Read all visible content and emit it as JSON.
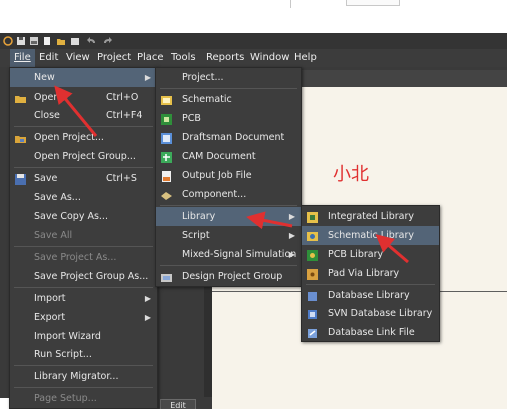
{
  "menubar": {
    "items": [
      "File",
      "Edit",
      "View",
      "Project",
      "Place",
      "Tools",
      "Reports",
      "Window",
      "Help"
    ]
  },
  "file_menu": {
    "items": [
      {
        "label": "New",
        "shortcut": "",
        "submenu": true,
        "highlighted": true,
        "disabled": false,
        "icon": ""
      },
      {
        "label": "Open...",
        "shortcut": "Ctrl+O",
        "submenu": false,
        "disabled": false,
        "icon": "folder-icon"
      },
      {
        "label": "Close",
        "shortcut": "Ctrl+F4",
        "submenu": false,
        "disabled": false,
        "icon": ""
      },
      {
        "label": "Open Project...",
        "shortcut": "",
        "submenu": false,
        "disabled": false,
        "icon": "open-project-icon"
      },
      {
        "label": "Open Project Group...",
        "shortcut": "",
        "submenu": false,
        "disabled": false,
        "icon": ""
      },
      {
        "label": "Save",
        "shortcut": "Ctrl+S",
        "submenu": false,
        "disabled": false,
        "icon": "save-icon"
      },
      {
        "label": "Save As...",
        "shortcut": "",
        "submenu": false,
        "disabled": false,
        "icon": ""
      },
      {
        "label": "Save Copy As...",
        "shortcut": "",
        "submenu": false,
        "disabled": false,
        "icon": ""
      },
      {
        "label": "Save All",
        "shortcut": "",
        "submenu": false,
        "disabled": true,
        "icon": ""
      },
      {
        "label": "Save Project As...",
        "shortcut": "",
        "submenu": false,
        "disabled": true,
        "icon": ""
      },
      {
        "label": "Save Project Group As...",
        "shortcut": "",
        "submenu": false,
        "disabled": false,
        "icon": ""
      },
      {
        "label": "Import",
        "shortcut": "",
        "submenu": true,
        "disabled": false,
        "icon": ""
      },
      {
        "label": "Export",
        "shortcut": "",
        "submenu": true,
        "disabled": false,
        "icon": ""
      },
      {
        "label": "Import Wizard",
        "shortcut": "",
        "submenu": false,
        "disabled": false,
        "icon": ""
      },
      {
        "label": "Run Script...",
        "shortcut": "",
        "submenu": false,
        "disabled": false,
        "icon": ""
      },
      {
        "label": "Library Migrator...",
        "shortcut": "",
        "submenu": false,
        "disabled": false,
        "icon": ""
      },
      {
        "label": "Page Setup...",
        "shortcut": "",
        "submenu": false,
        "disabled": true,
        "icon": ""
      }
    ]
  },
  "new_menu": {
    "items": [
      {
        "label": "Project...",
        "submenu": false,
        "highlighted": false,
        "icon": ""
      },
      {
        "label": "Schematic",
        "submenu": false,
        "highlighted": false,
        "icon": "schematic-icon"
      },
      {
        "label": "PCB",
        "submenu": false,
        "highlighted": false,
        "icon": "pcb-icon"
      },
      {
        "label": "Draftsman Document",
        "submenu": false,
        "highlighted": false,
        "icon": "draftsman-icon"
      },
      {
        "label": "CAM Document",
        "submenu": false,
        "highlighted": false,
        "icon": "cam-icon"
      },
      {
        "label": "Output Job File",
        "submenu": false,
        "highlighted": false,
        "icon": "output-job-icon"
      },
      {
        "label": "Component...",
        "submenu": false,
        "highlighted": false,
        "icon": "component-icon"
      },
      {
        "label": "Library",
        "submenu": true,
        "highlighted": true,
        "icon": ""
      },
      {
        "label": "Script",
        "submenu": true,
        "highlighted": false,
        "icon": ""
      },
      {
        "label": "Mixed-Signal Simulation",
        "submenu": true,
        "highlighted": false,
        "icon": ""
      },
      {
        "label": "Design Project Group",
        "submenu": false,
        "highlighted": false,
        "icon": "project-group-icon"
      }
    ]
  },
  "library_menu": {
    "items": [
      {
        "label": "Integrated Library",
        "highlighted": false,
        "icon": "integrated-library-icon"
      },
      {
        "label": "Schematic Library",
        "highlighted": true,
        "icon": "schematic-library-icon"
      },
      {
        "label": "PCB Library",
        "highlighted": false,
        "icon": "pcb-library-icon"
      },
      {
        "label": "Pad Via Library",
        "highlighted": false,
        "icon": "pad-via-library-icon"
      },
      {
        "label": "Database Library",
        "highlighted": false,
        "icon": "database-library-icon"
      },
      {
        "label": "SVN Database Library",
        "highlighted": false,
        "icon": "svn-database-library-icon"
      },
      {
        "label": "Database Link File",
        "highlighted": false,
        "icon": "database-link-icon"
      }
    ]
  },
  "annotation_text": "小北",
  "edit_button": "Edit",
  "colors": {
    "menu_bg": "#3d3d3d",
    "highlight": "#536477",
    "annotation_red": "#e03030",
    "document_bg": "#f7f3ea"
  }
}
